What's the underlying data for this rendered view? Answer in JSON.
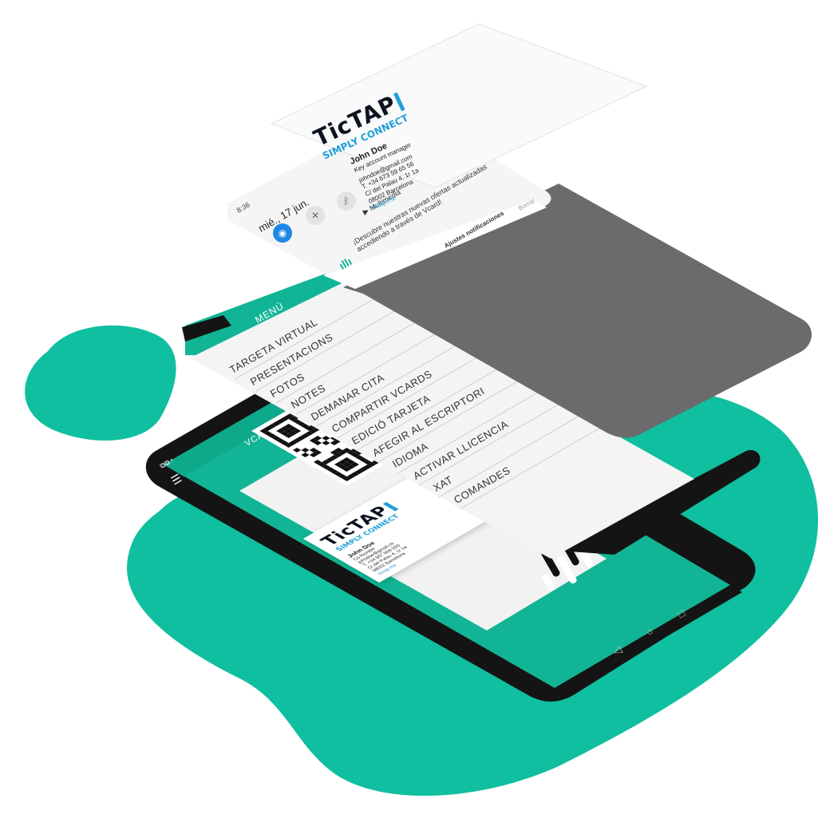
{
  "colors": {
    "brand_green": "#11b595",
    "blob_green": "#0fbf9f",
    "phone_body": "#141414",
    "overlay_grey": "#6a6a6a",
    "accent_blue": "#1fa0d8"
  },
  "business_card": {
    "brand": "TicTAP",
    "tagline": "SIMPLY CONNECT",
    "name": "John Doe",
    "role": "Key account manager",
    "email": "johndoe@gmail.com",
    "phone": "T. +34 673 59 65 56",
    "address": "C/ del Palau 4, 1r 1a",
    "city": "08002 Barcelona",
    "website": "tictap.me"
  },
  "notification_panel": {
    "time": "8:36",
    "date": "mié., 17 jun.",
    "media_label": "Multimedia",
    "message": "¡Descubre nuestras nuevas ofertas actualizadas accediendo a través de Vcard!",
    "settings_label": "Ajustes notificaciones",
    "clear_label": "Borrar"
  },
  "menu": {
    "title": "MENÚ",
    "items": [
      "TARGETA VIRTUAL",
      "PRESENTACIONS",
      "FOTOS",
      "NOTES",
      "DEMANAR CITA",
      "COMPARTIR VCARDS",
      "EDICIÓ TARJETA",
      "AFEGIR AL ESCRIPTORI",
      "IDIOMA",
      "ACTIVAR LLICENCIA",
      "XAT",
      "COMANDES"
    ]
  },
  "vcard_screen": {
    "title": "VCARD",
    "brand": "TicTAP",
    "tagline": "SIMPLY CONNECT",
    "name": "John Doe",
    "role": "Co-founder",
    "email": "johndoe@gmail.co",
    "phone": "T. +34 667 669 939",
    "address": "C/ del Palau 4, 1r 1a",
    "city": "08002 Barcelona",
    "website": "tictap.me"
  },
  "icons": {
    "hamburger": "menu-icon",
    "wifi": "wifi-icon",
    "bluetooth": "bluetooth-icon",
    "mute": "mute-icon",
    "back": "back-nav-icon",
    "home": "home-nav-icon",
    "recents": "recents-nav-icon",
    "app_logo": "tictap-logo-icon"
  }
}
